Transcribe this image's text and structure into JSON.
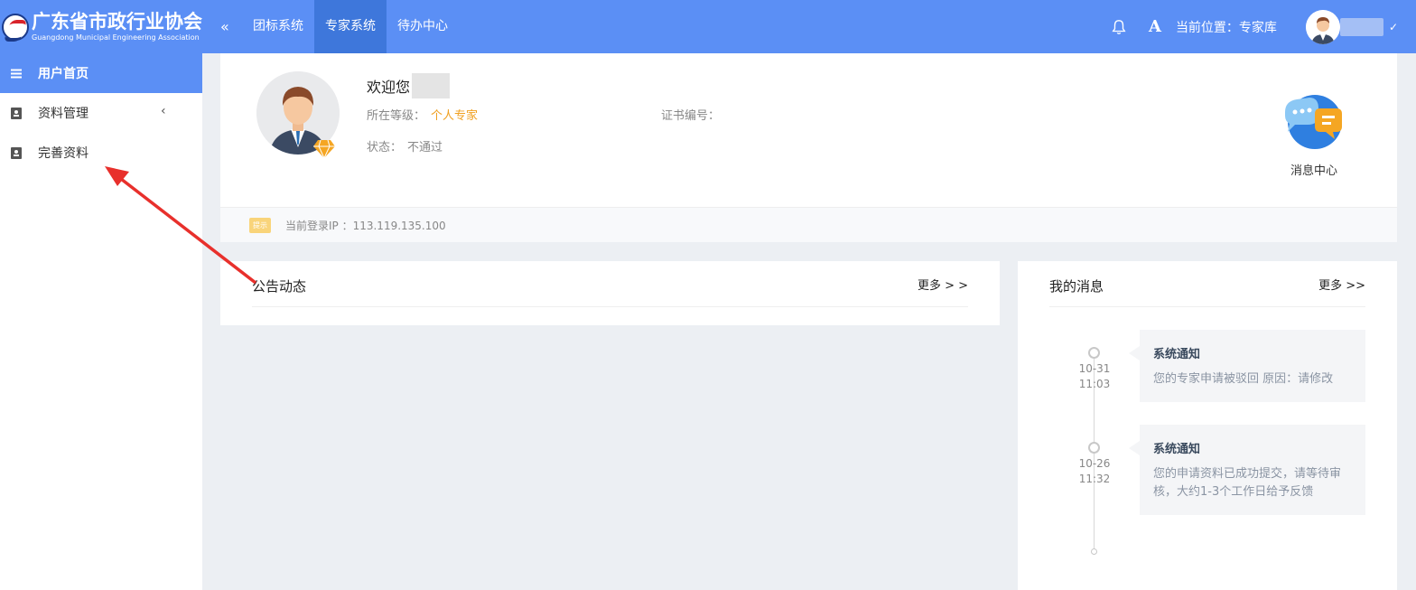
{
  "header": {
    "logo_cn": "广东省市政行业协会",
    "logo_en": "Guangdong Municipal Engineering Association",
    "collapse_icon": "«",
    "nav": [
      {
        "label": "团标系统",
        "active": false
      },
      {
        "label": "专家系统",
        "active": true
      },
      {
        "label": "待办中心",
        "active": false
      }
    ],
    "font_icon": "A",
    "location": "当前位置：专家库",
    "user_chevron": "✓"
  },
  "sidebar": {
    "items": [
      {
        "label": "用户首页",
        "icon": "menu-icon",
        "active": true
      },
      {
        "label": "资料管理",
        "icon": "profile-card-icon",
        "arrow": "‹"
      },
      {
        "label": "完善资料",
        "icon": "profile-card-icon"
      }
    ]
  },
  "profile": {
    "welcome": "欢迎您",
    "level_label": "所在等级：",
    "level_value": "个人专家",
    "cert_label": "证书编号：",
    "status_label": "状态：",
    "status_value": "不通过",
    "message_center": "消息中心",
    "tip_badge": "提示",
    "ip_text": "当前登录IP ：113.119.135.100"
  },
  "announcements": {
    "title": "公告动态",
    "more": "更多 > >"
  },
  "messages": {
    "title": "我的消息",
    "more": "更多 >>",
    "items": [
      {
        "date": "10-31",
        "time": "11:03",
        "title": "系统通知",
        "body": "您的专家申请被驳回 原因：请修改"
      },
      {
        "date": "10-26",
        "time": "11:32",
        "title": "系统通知",
        "body": "您的申请资料已成功提交，请等待审核，大约1-3个工作日给予反馈"
      }
    ]
  },
  "colors": {
    "header_bg": "#5b8ff5",
    "nav_active": "#3e77db",
    "level_value": "#f0a020",
    "annotation_arrow": "#e8302c"
  }
}
